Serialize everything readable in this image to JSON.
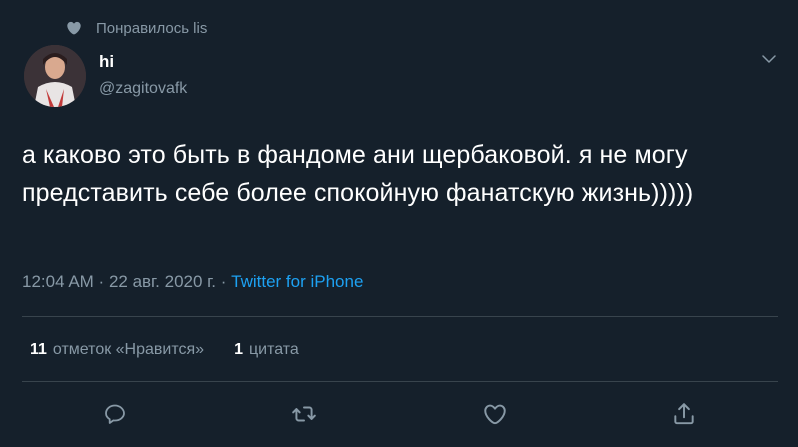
{
  "social_context": {
    "text": "Понравилось lis",
    "icon": "heart-icon"
  },
  "author": {
    "name": "hi",
    "handle": "@zagitovafk",
    "avatar": "avatar"
  },
  "tweet": {
    "text": "а каково это быть в фандоме ани щербаковой. я не могу представить себе более спокойную фанатскую жизнь)))))",
    "time": "12:04 AM",
    "separator1": " · ",
    "date": "22 авг. 2020 г.",
    "separator2": " · ",
    "source": "Twitter for iPhone"
  },
  "stats": {
    "likes_count": "11",
    "likes_label": "отметок «Нравится»",
    "quotes_count": "1",
    "quotes_label": "цитата"
  },
  "actions": [
    "reply-icon",
    "retweet-icon",
    "like-icon",
    "share-icon"
  ],
  "colors": {
    "background": "#15202b",
    "text": "#ffffff",
    "secondary": "#8899a6",
    "link": "#1da1f2",
    "divider": "#38444d"
  }
}
